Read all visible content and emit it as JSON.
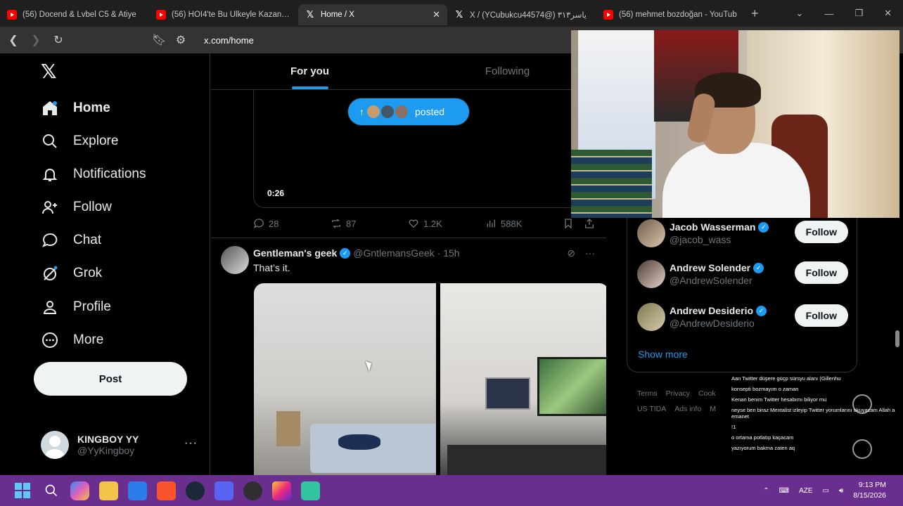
{
  "browser": {
    "tabs": [
      {
        "title": "(56) Docend & Lvbel C5 & Atiye",
        "icon": "youtube-icon"
      },
      {
        "title": "(56) HOI4'te Bu Ülkeyle Kazanma",
        "icon": "youtube-icon"
      },
      {
        "title": "Home / X",
        "icon": "x-icon"
      },
      {
        "title": "X / (YCubukcu44574@) ۳۱۳یاسر",
        "icon": "x-icon"
      },
      {
        "title": "(56) mehmet bozdoğan - YouTub",
        "icon": "youtube-icon"
      }
    ],
    "new_tab": "+",
    "url": "x.com/home"
  },
  "sidebar": {
    "logo": "𝕏",
    "items": [
      {
        "label": "Home",
        "icon": "home-icon"
      },
      {
        "label": "Explore",
        "icon": "search-icon"
      },
      {
        "label": "Notifications",
        "icon": "bell-icon"
      },
      {
        "label": "Follow",
        "icon": "person-plus-icon"
      },
      {
        "label": "Chat",
        "icon": "chat-icon"
      },
      {
        "label": "Grok",
        "icon": "grok-icon"
      },
      {
        "label": "Profile",
        "icon": "person-icon"
      },
      {
        "label": "More",
        "icon": "more-circle-icon"
      }
    ],
    "post_label": "Post",
    "account": {
      "name": "KINGBOY YY",
      "handle": "@YyKingboy",
      "more": "···"
    }
  },
  "feed": {
    "tabs": [
      {
        "label": "For you",
        "active": true
      },
      {
        "label": "Following",
        "active": false
      }
    ],
    "posted_pill": "posted",
    "video_time": "0:26",
    "actions": {
      "replies": "28",
      "reposts": "87",
      "likes": "1.2K",
      "views": "588K"
    },
    "tweet": {
      "name": "Gentleman's geek",
      "handle": "@GntlemansGeek",
      "time": "· 15h",
      "text": "That’s it."
    }
  },
  "who_to_follow": {
    "users": [
      {
        "name": "Jacob Wasserman",
        "handle": "@jacob_wass",
        "button": "Follow"
      },
      {
        "name": "Andrew Solender",
        "handle": "@AndrewSolender",
        "button": "Follow"
      },
      {
        "name": "Andrew Desiderio",
        "handle": "@AndrewDesiderio",
        "button": "Follow"
      }
    ],
    "show_more": "Show more"
  },
  "footer": {
    "links": [
      "Terms",
      "Privacy",
      "Cook",
      "US TIDA",
      "Ads info",
      "M"
    ]
  },
  "chat_overlay": {
    "messages": [
      "Aan Twitter düşere güçp sürsyu alanı (Gillenhu",
      "konsepti bozmayım o zaman",
      "Kenan benim Twitter hesabımı biliyor mu",
      "neyse ben biraz Mentalist izleyip Twitter yorumlarını okuyacam Allah a emanet",
      "!1",
      "o ortama potlatıp kaçacam",
      "yazıyorum bakma zaten aq"
    ]
  },
  "taskbar": {
    "lang": "AZE",
    "time": "9:13 PM",
    "date": "8/15/2026"
  },
  "colors": {
    "accent": "#1d9bf0",
    "taskbar": "#6a2e8e",
    "background": "#000000"
  }
}
